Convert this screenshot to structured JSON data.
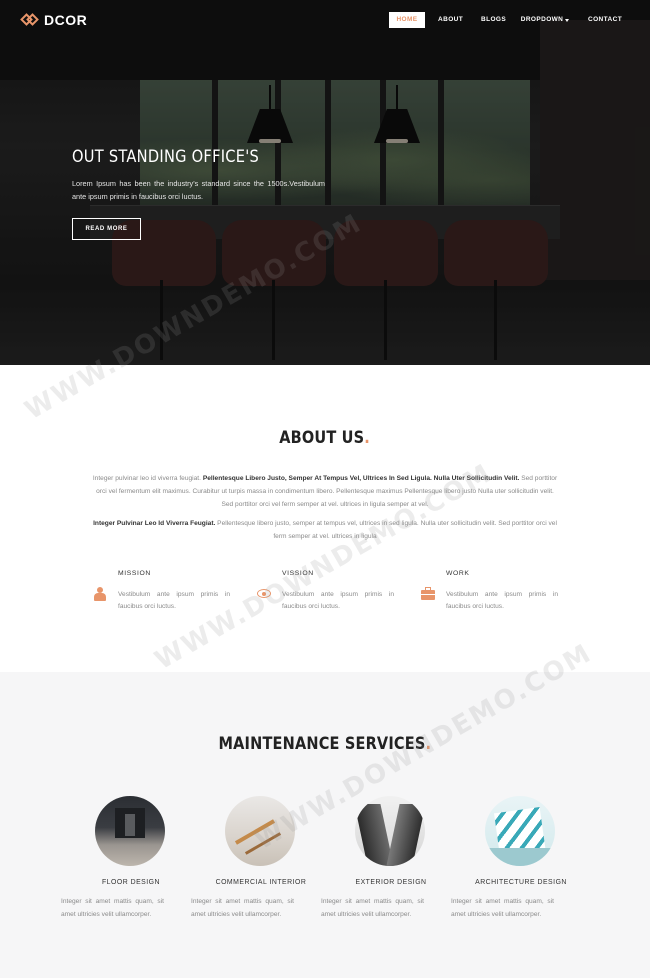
{
  "brand": {
    "name": "DCOR",
    "accent": "#e8956a"
  },
  "nav": {
    "items": [
      {
        "label": "HOME",
        "active": true
      },
      {
        "label": "ABOUT"
      },
      {
        "label": "BLOGS"
      },
      {
        "label": "DROPDOWN"
      },
      {
        "label": "CONTACT"
      }
    ]
  },
  "hero": {
    "title": "OUT STANDING OFFICE'S",
    "text": "Lorem Ipsum has been the industry's standard since the 1500s.Vestibulum ante ipsum primis in faucibus orci luctus.",
    "button": "READ MORE"
  },
  "about": {
    "title": "ABOUT US",
    "title_dot": ".",
    "p1_lead": "Integer pulvinar leo id viverra feugiat. ",
    "p1_bold": "Pellentesque Libero Justo, Semper At Tempus Vel, Ultrices In Sed Ligula. Nulla Uter Sollicitudin Velit.",
    "p1_rest": " Sed porttitor orci vel fermentum elit maximus. Curabitur ut turpis massa in condimentum libero. Pellentesque maximus Pellentesque libero justo Nulla uter sollicitudin velit. Sed porttitor orci vel ferm semper at vel. ultrices in ligula semper at vel.",
    "p2_bold": "Integer Pulvinar Leo Id Viverra Feugiat.",
    "p2_rest": " Pellentesque libero justo, semper at tempus vel, ultrices in sed ligula. Nulla uter sollicitudin velit. Sed porttitor orci vel ferm semper at vel. ultrices in ligula",
    "features": [
      {
        "icon": "person-icon",
        "title": "MISSION",
        "text": "Vestibulum ante ipsum primis in faucibus orci luctus."
      },
      {
        "icon": "eye-icon",
        "title": "VISSION",
        "text": "Vestibulum ante ipsum primis in faucibus orci luctus."
      },
      {
        "icon": "briefcase-icon",
        "title": "WORK",
        "text": "Vestibulum ante ipsum primis in faucibus orci luctus."
      }
    ]
  },
  "services": {
    "title": "MAINTENANCE SERVICES",
    "title_dot": ".",
    "items": [
      {
        "title": "FLOOR DESIGN",
        "text": "Integer sit amet mattis quam, sit amet ultricies velit ullamcorper."
      },
      {
        "title": "COMMERCIAL INTERIOR",
        "text": "Integer sit amet mattis quam, sit amet ultricies velit ullamcorper."
      },
      {
        "title": "EXTERIOR DESIGN",
        "text": "Integer sit amet mattis quam, sit amet ultricies velit ullamcorper."
      },
      {
        "title": "ARCHITECTURE DESIGN",
        "text": "Integer sit amet mattis quam, sit amet ultricies velit ullamcorper."
      }
    ]
  },
  "watermark": "WWW.DOWNDEMO.COM"
}
